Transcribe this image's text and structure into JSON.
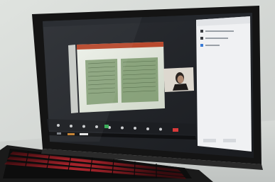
{
  "scene": {
    "description": "laptop-on-desk",
    "colors": {
      "wall": "#d9dcd8",
      "bezel": "#141414",
      "screen_dark": "#1f2227",
      "slide_bg": "#dfe5db",
      "panel_bg": "#f1f2f4",
      "keyboard": "#101010",
      "key_backlight": "#d0222a",
      "desk": "#cfd2d0"
    }
  },
  "meeting": {
    "window_title": "",
    "slide_title": "",
    "participants_header": "",
    "participant_lines": [
      "",
      ""
    ],
    "toolbar_labels": [
      "",
      "",
      "",
      "",
      "",
      "",
      "",
      ""
    ],
    "end_label": ""
  }
}
